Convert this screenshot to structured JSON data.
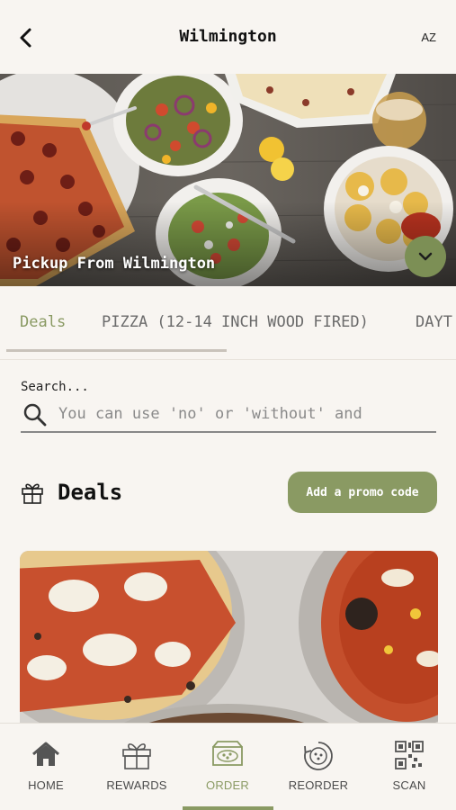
{
  "header": {
    "title": "Wilmington",
    "language": "AZ"
  },
  "hero": {
    "caption": "Pickup From Wilmington"
  },
  "tabs": [
    {
      "label": "Deals",
      "active": true
    },
    {
      "label": "PIZZA (12-14 INCH WOOD FIRED)",
      "active": false
    },
    {
      "label": "DAYT",
      "active": false
    }
  ],
  "search": {
    "label": "Search...",
    "placeholder": "You can use 'no' or 'without' and"
  },
  "deals": {
    "title": "Deals",
    "promo_button": "Add a promo code"
  },
  "bottom_nav": [
    {
      "label": "HOME",
      "icon": "home-icon"
    },
    {
      "label": "REWARDS",
      "icon": "gift-icon"
    },
    {
      "label": "ORDER",
      "icon": "pizza-box-icon",
      "active": true
    },
    {
      "label": "REORDER",
      "icon": "reorder-icon"
    },
    {
      "label": "SCAN",
      "icon": "qr-code-icon"
    }
  ],
  "colors": {
    "accent": "#8a9a63",
    "background": "#f8f5f1"
  }
}
